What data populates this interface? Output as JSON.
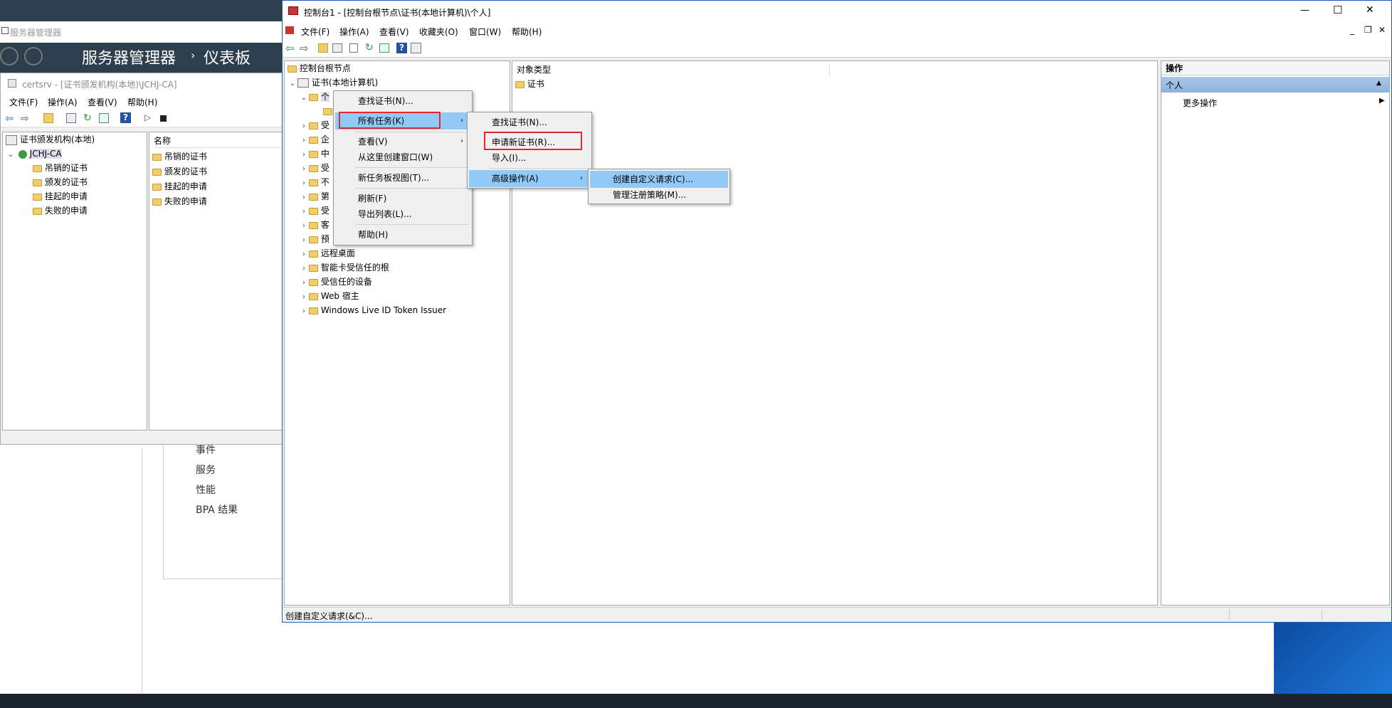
{
  "desktop": {
    "accent": "#1a5fb4"
  },
  "server_manager": {
    "title": "服务器管理器",
    "header_title": "服务器管理器",
    "header_sep": "›",
    "header_page": "仪表板",
    "panel_items": [
      "事件",
      "服务",
      "性能",
      "BPA 结果"
    ]
  },
  "certsrv": {
    "title": "certsrv - [证书颁发机构(本地)\\JCHJ-CA]",
    "menu": [
      "文件(F)",
      "操作(A)",
      "查看(V)",
      "帮助(H)"
    ],
    "tree_root": "证书颁发机构(本地)",
    "tree_ca": "JCHJ-CA",
    "tree_children": [
      "吊销的证书",
      "颁发的证书",
      "挂起的申请",
      "失败的申请"
    ],
    "list_header": "名称",
    "list_items": [
      "吊销的证书",
      "颁发的证书",
      "挂起的申请",
      "失败的申请"
    ]
  },
  "console": {
    "title": "控制台1 - [控制台根节点\\证书(本地计算机)\\个人]",
    "menu": [
      "文件(F)",
      "操作(A)",
      "查看(V)",
      "收藏夹(O)",
      "窗口(W)",
      "帮助(H)"
    ],
    "window_controls": {
      "minimize": "—",
      "maximize": "☐",
      "close": "✕"
    },
    "inner_controls": {
      "minimize": "_",
      "restore": "❐",
      "close": "✕"
    },
    "tree": {
      "root": "控制台根节点",
      "certs": "证书(本地计算机)",
      "personal": "个",
      "truncated": [
        "受",
        "企",
        "中",
        "受",
        "不",
        "第",
        "受",
        "客",
        "预"
      ],
      "items": [
        "远程桌面",
        "智能卡受信任的根",
        "受信任的设备",
        "Web 宿主",
        "Windows Live ID Token Issuer"
      ]
    },
    "list_header": "对象类型",
    "list_items": [
      "证书"
    ],
    "actions": {
      "header": "操作",
      "section": "个人",
      "more": "更多操作"
    },
    "status": "创建自定义请求(&C)..."
  },
  "context_menu": {
    "items": [
      "查找证书(N)...",
      "所有任务(K)",
      "查看(V)",
      "从这里创建窗口(W)",
      "新任务板视图(T)...",
      "刷新(F)",
      "导出列表(L)...",
      "帮助(H)"
    ]
  },
  "submenu_all_tasks": {
    "items": [
      "查找证书(N)...",
      "申请新证书(R)...",
      "导入(I)...",
      "高级操作(A)"
    ]
  },
  "submenu_advanced": {
    "items": [
      "创建自定义请求(C)...",
      "管理注册策略(M)..."
    ]
  }
}
